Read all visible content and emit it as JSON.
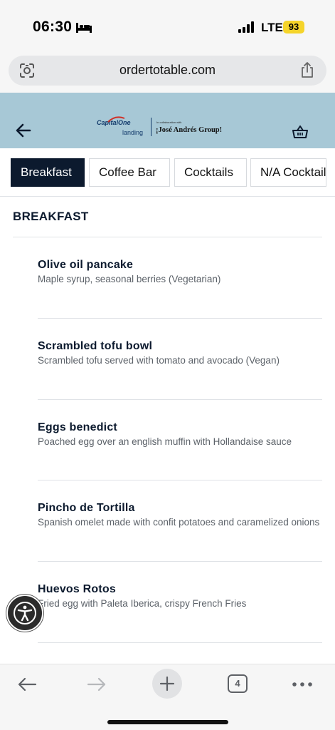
{
  "status_bar": {
    "time": "06:30",
    "network": "LTE",
    "battery": "93"
  },
  "browser": {
    "url": "ordertotable.com",
    "tab_count": "4"
  },
  "header": {
    "logo_capital": "Capital",
    "logo_one": "One",
    "logo_landing": "landing",
    "logo_collab": "In collaboration with",
    "logo_group": "¡José Andrés Group!"
  },
  "tabs": [
    {
      "label": "Breakfast",
      "active": true
    },
    {
      "label": "Coffee Bar",
      "active": false
    },
    {
      "label": "Cocktails",
      "active": false
    },
    {
      "label": "N/A Cocktails",
      "active": false
    }
  ],
  "section": {
    "title": "BREAKFAST"
  },
  "items": [
    {
      "name": "Olive oil pancake",
      "desc": "Maple syrup, seasonal berries (Vegetarian)"
    },
    {
      "name": "Scrambled tofu bowl",
      "desc": "Scrambled tofu served with tomato and avocado (Vegan)"
    },
    {
      "name": "Eggs benedict",
      "desc": "Poached egg over an english muffin with Hollandaise sauce"
    },
    {
      "name": "Pincho de Tortilla",
      "desc": "Spanish omelet made with confit potatoes and caramelized onions"
    },
    {
      "name": "Huevos Rotos",
      "desc": "Fried egg with Paleta Iberica, crispy French Fries"
    }
  ],
  "icons": {
    "status": [
      "bed-icon",
      "signal-icon"
    ],
    "url_bar": [
      "lens-icon",
      "share-icon"
    ],
    "header": [
      "back-arrow-icon",
      "basket-icon"
    ],
    "floating": [
      "accessibility-icon"
    ],
    "bottom": [
      "back-icon",
      "forward-icon",
      "plus-icon",
      "more-icon"
    ]
  },
  "colors": {
    "header_bg": "#a7c8d6",
    "navy": "#0c1a2e",
    "battery": "#f5d42a"
  }
}
